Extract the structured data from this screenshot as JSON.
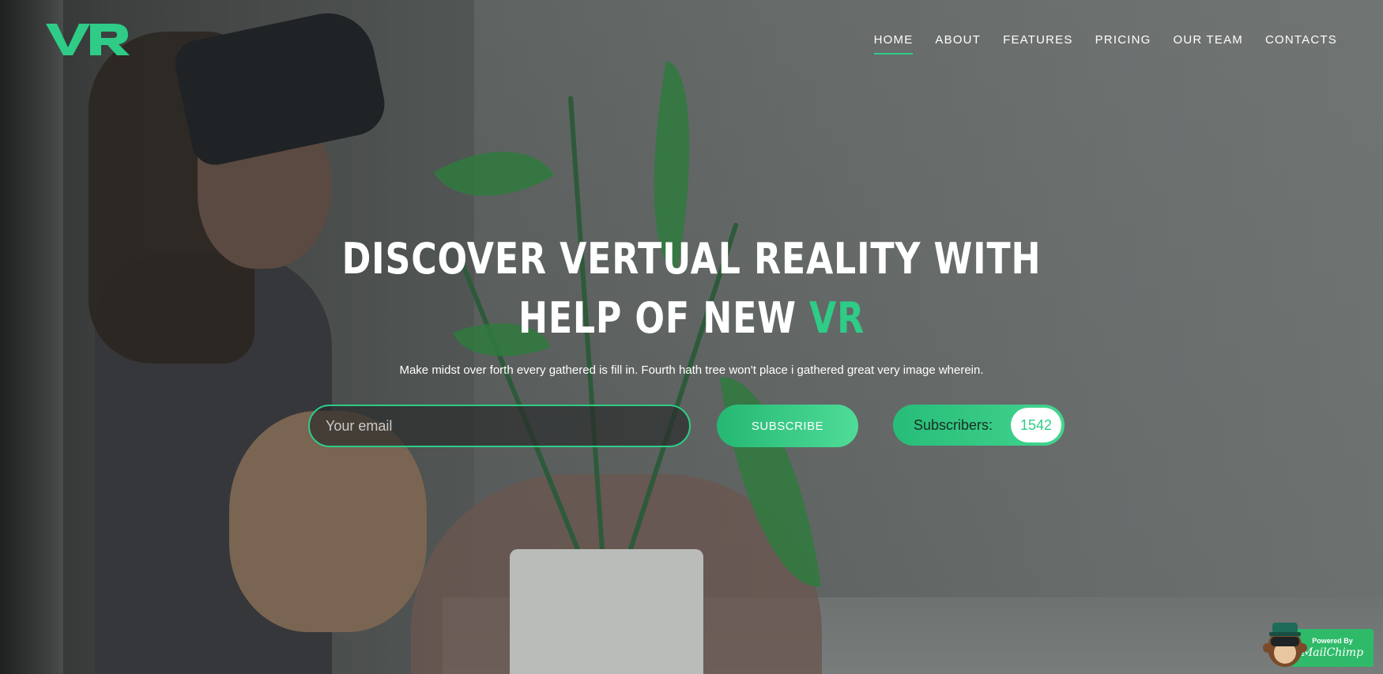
{
  "header": {
    "logo_text": "VR",
    "nav": [
      {
        "label": "HOME",
        "active": true
      },
      {
        "label": "ABOUT",
        "active": false
      },
      {
        "label": "FEATURES",
        "active": false
      },
      {
        "label": "PRICING",
        "active": false
      },
      {
        "label": "OUR TEAM",
        "active": false
      },
      {
        "label": "CONTACTS",
        "active": false
      }
    ]
  },
  "hero": {
    "headline_line1": "DISCOVER VERTUAL REALITY WITH",
    "headline_line2_prefix": "HELP OF NEW ",
    "headline_accent": "VR",
    "subtitle": "Make midst over forth every gathered is fill in. Fourth hath tree won't place i gathered great very image wherein."
  },
  "form": {
    "email_placeholder": "Your email",
    "email_value": "",
    "subscribe_label": "SUBSCRIBE",
    "subscribers_label": "Subscribers:",
    "subscribers_count": "1542"
  },
  "badge": {
    "powered_by": "Powered By",
    "name": "MailChimp"
  },
  "colors": {
    "accent": "#2ecc87",
    "text": "#ffffff"
  }
}
